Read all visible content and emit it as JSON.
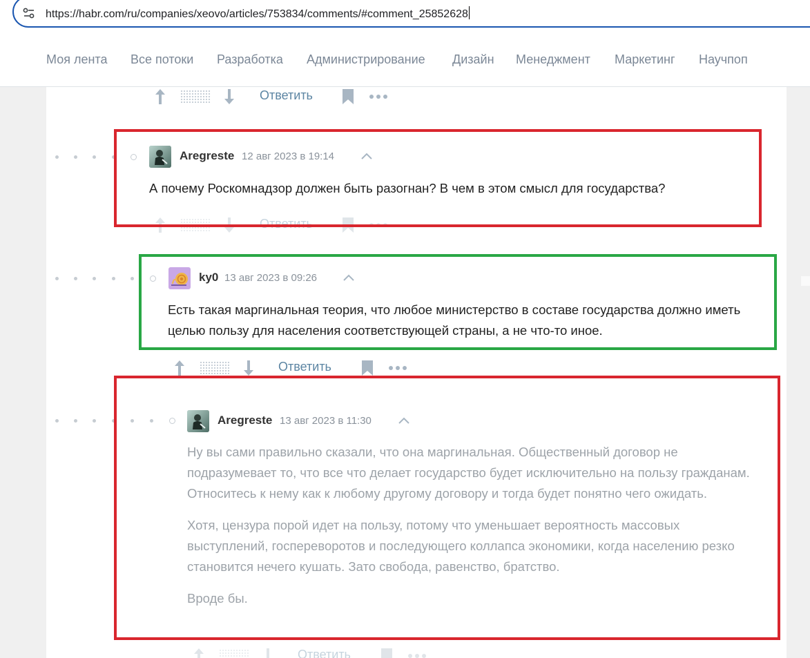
{
  "browser": {
    "url": "https://habr.com/ru/companies/xeovo/articles/753834/comments/#comment_25852628",
    "site_icon": "tune-icon"
  },
  "nav": {
    "items": [
      "Моя лента",
      "Все потоки",
      "Разработка",
      "Администрирование",
      "Дизайн",
      "Менеджмент",
      "Маркетинг",
      "Научпоп"
    ]
  },
  "actions_label": "Ответить",
  "comments": [
    {
      "username": "Aregreste",
      "date": "12 авг 2023 в 19:14",
      "text": [
        "А почему Роскомнадзор должен быть разогнан? В чем в этом смысл для государства?"
      ]
    },
    {
      "username": "ky0",
      "date": "13 авг 2023 в 09:26",
      "text": [
        "Есть такая маргинальная теория, что любое министерство в составе государства должно иметь целью пользу для населения соответствующей страны, а не что-то иное."
      ]
    },
    {
      "username": "Aregreste",
      "date": "13 авг 2023 в 11:30",
      "text": [
        "Ну вы сами правильно сказали, что она маргинальная. Общественный договор не подразумевает то, что все что делает государство будет исключительно на пользу гражданам. Относитесь к нему как к любому другому договору и тогда будет понятно чего ожидать.",
        "Хотя, цензура порой идет на пользу, потому что уменьшает вероятность массовых выступлений, госпереворотов и последующего коллапса экономики, когда населению резко становится нечего кушать. Зато свобода, равенство, братство.",
        "Вроде бы."
      ]
    }
  ],
  "colors": {
    "highlight_red": "#d9262e",
    "highlight_green": "#29a745",
    "link": "#5c85a3"
  }
}
